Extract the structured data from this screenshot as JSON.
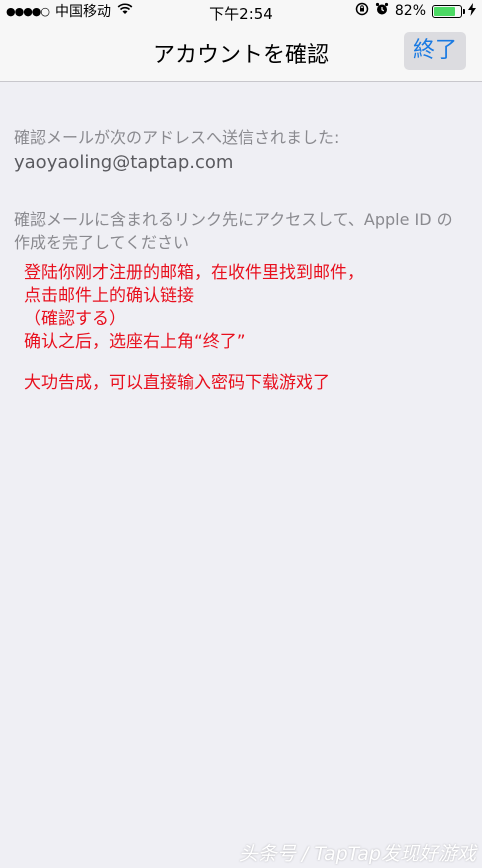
{
  "status_bar": {
    "signal": "●●●●○",
    "carrier": "中国移动",
    "wifi_icon": "wifi-icon",
    "time": "下午2:54",
    "lock_icon": "rotation-lock-icon",
    "alarm_icon": "alarm-icon",
    "battery_percent": "82%",
    "battery_level": 0.82,
    "charging_icon": "charging-bolt-icon"
  },
  "nav": {
    "title": "アカウントを確認",
    "done_label": "終了"
  },
  "content": {
    "sent_message": "確認メールが次のアドレスへ送信されました:",
    "email": "yaoyaoling@taptap.com",
    "instruction": "確認メールに含まれるリンク先にアクセスして、Apple ID の作成を完了してください"
  },
  "annotation": {
    "line1": "登陆你刚才注册的邮箱，在收件里找到邮件，",
    "line2": "点击邮件上的确认链接",
    "line3": "（確認する）",
    "line4": "确认之后，选座右上角“终了”",
    "line5": "大功告成，可以直接输入密码下载游戏了"
  },
  "watermark": "头条号 / TapTap发现好游戏",
  "colors": {
    "accent": "#1a7ae2",
    "annotation": "#e8101e",
    "background": "#efeff4"
  }
}
